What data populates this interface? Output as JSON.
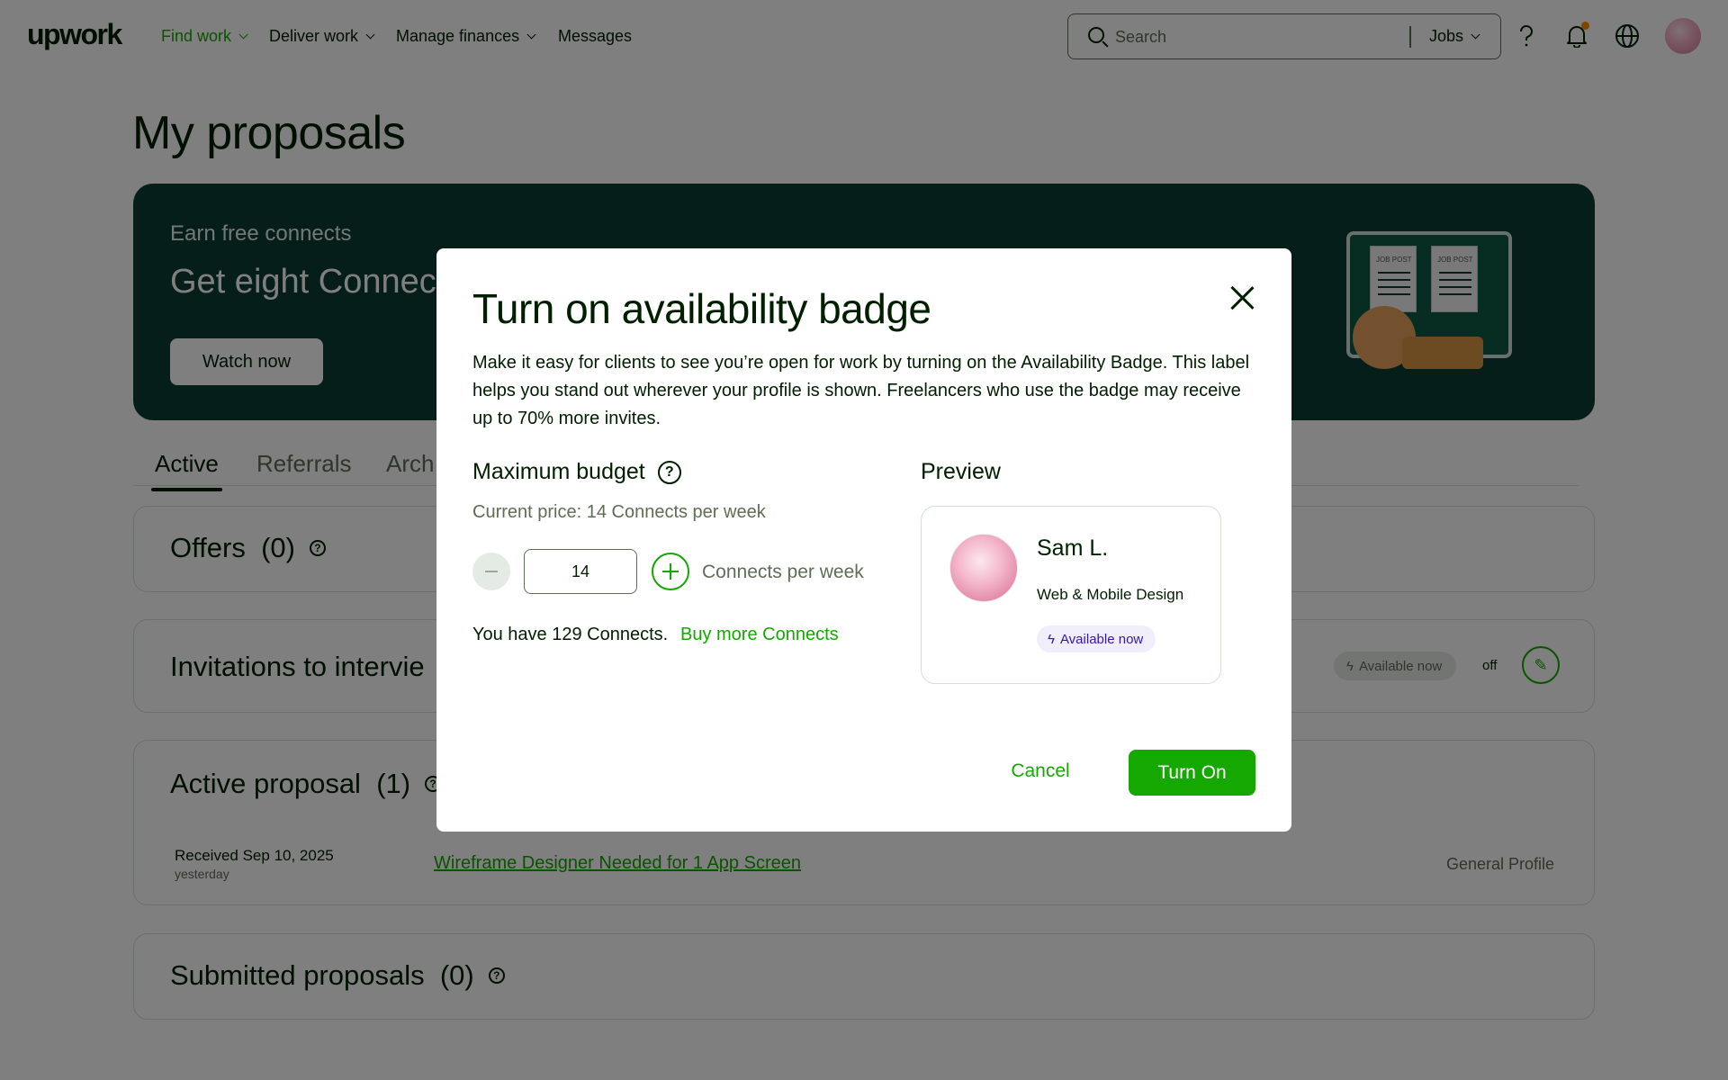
{
  "nav": {
    "logo": "upwork",
    "items": [
      "Find work",
      "Deliver work",
      "Manage finances",
      "Messages"
    ],
    "search_placeholder": "Search",
    "search_scope": "Jobs",
    "icons": [
      "help-icon",
      "bell-icon",
      "globe-icon",
      "avatar"
    ]
  },
  "page": {
    "title": "My proposals"
  },
  "banner": {
    "kicker": "Earn free connects",
    "title": "Get eight Connects",
    "button": "Watch now",
    "paper_label": "JOB POST"
  },
  "tabs": [
    "Active",
    "Referrals",
    "Arch"
  ],
  "offers": {
    "title": "Offers",
    "count": "(0)"
  },
  "invitations": {
    "title": "Invitations to intervie",
    "badge": "Available now",
    "status": "off"
  },
  "active_proposal": {
    "title": "Active proposal",
    "count": "(1)",
    "received": "Received Sep 10, 2025",
    "received_sub": "yesterday",
    "job_title": "Wireframe Designer Needed for 1 App Screen",
    "profile": "General Profile"
  },
  "submitted": {
    "title": "Submitted proposals",
    "count": "(0)"
  },
  "modal": {
    "title": "Turn on availability badge",
    "description": "Make it easy for clients to see you’re open for work by turning on the Availability Badge. This label helps you stand out wherever your profile is shown. Freelancers who use the badge may receive up to 70% more invites.",
    "budget_title": "Maximum budget",
    "current_price": "Current price: 14 Connects per week",
    "stepper_value": "14",
    "stepper_unit": "Connects per week",
    "connects_count": "You have 129 Connects.",
    "buy_link": "Buy more Connects",
    "preview_title": "Preview",
    "preview": {
      "name": "Sam L.",
      "role": "Web & Mobile Design",
      "badge": "Available now"
    },
    "cancel": "Cancel",
    "confirm": "Turn On"
  },
  "colors": {
    "brand_green": "#14a800",
    "text": "#001e00",
    "muted": "#5e6d55",
    "banner_bg": "#0b3d33",
    "badge_purple": "#3a17a8"
  }
}
